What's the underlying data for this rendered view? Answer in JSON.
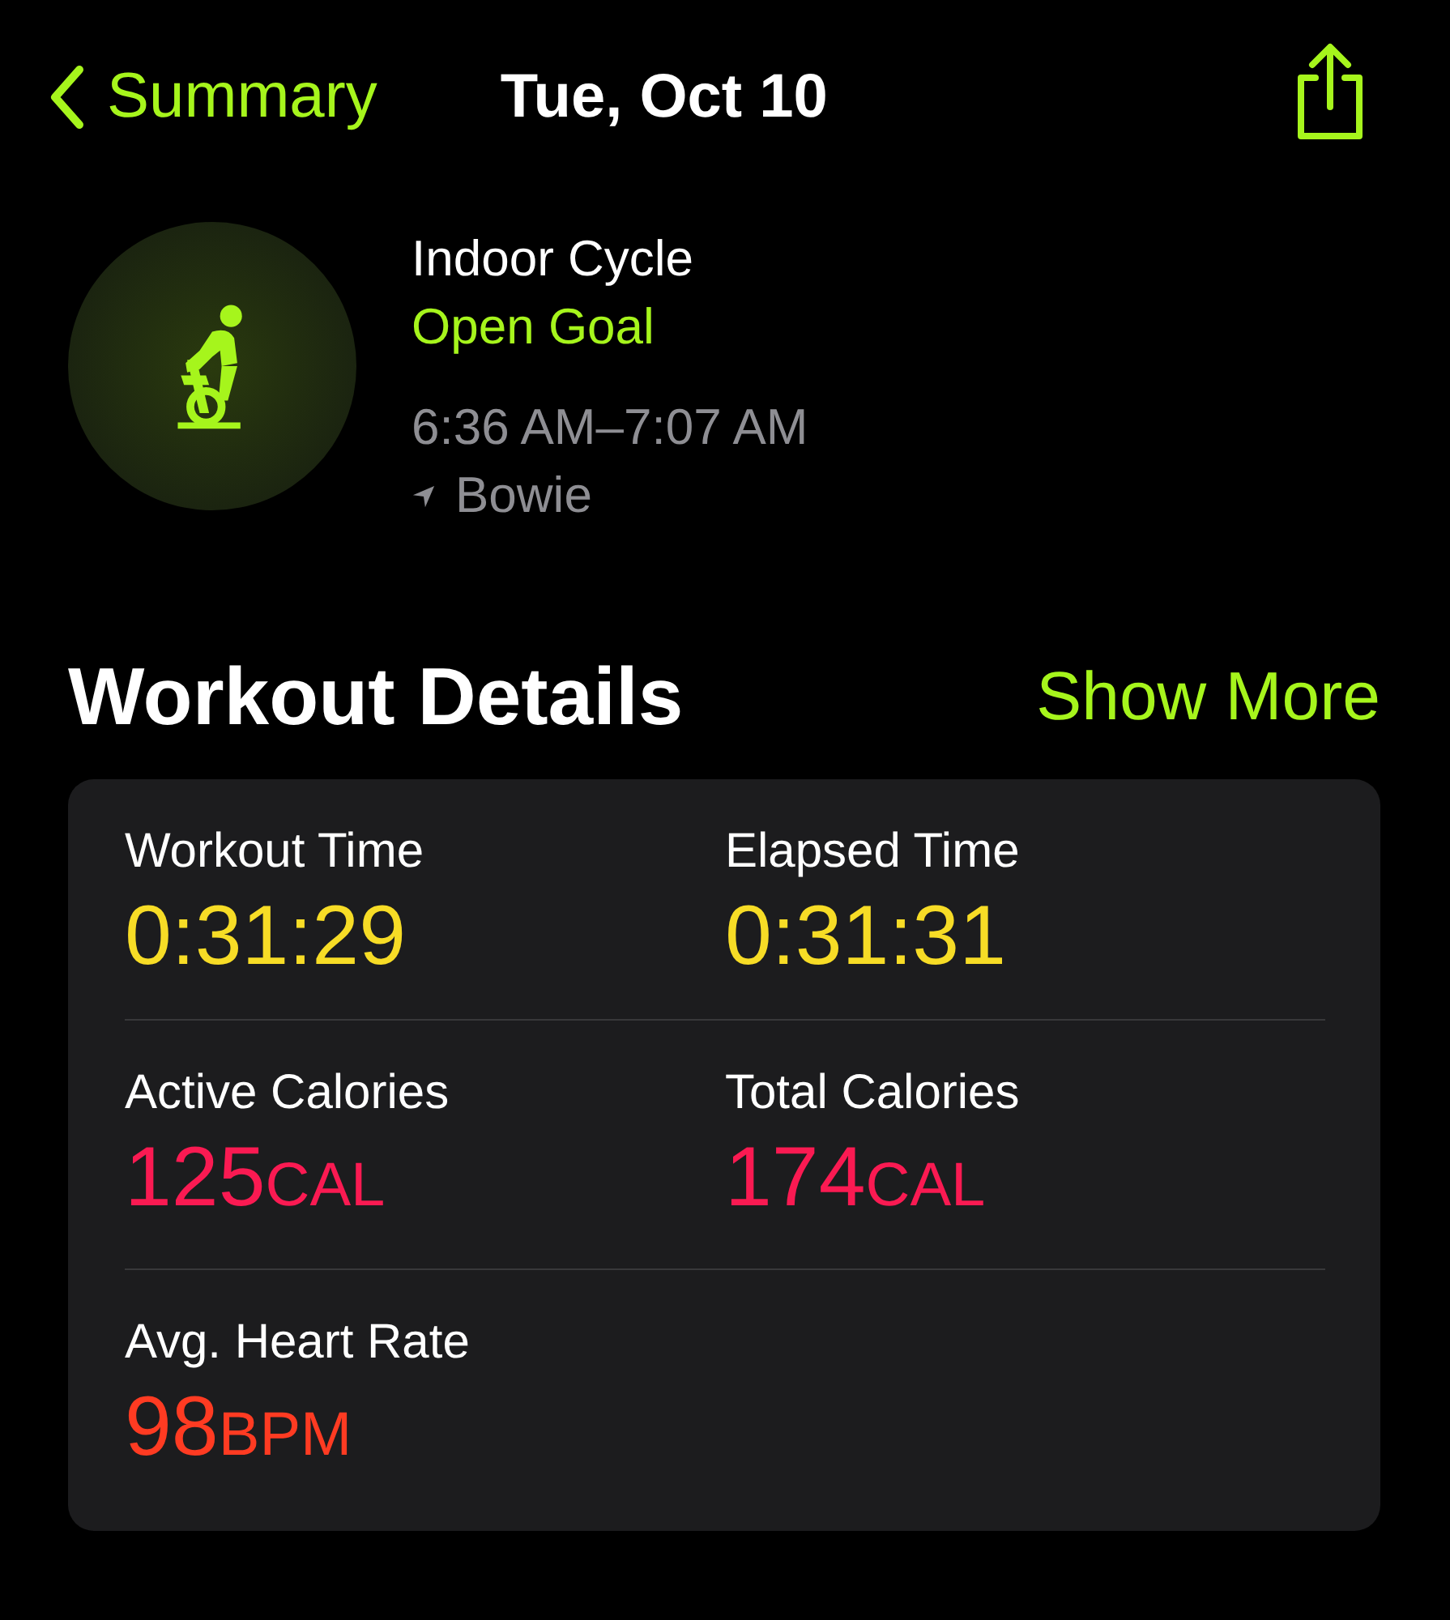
{
  "nav": {
    "back_label": "Summary",
    "title": "Tue, Oct 10"
  },
  "workout": {
    "name": "Indoor Cycle",
    "goal": "Open Goal",
    "time_range": "6:36 AM–7:07 AM",
    "location": "Bowie"
  },
  "section": {
    "title": "Workout Details",
    "action": "Show More"
  },
  "rows": [
    {
      "metrics": [
        {
          "label": "Workout Time",
          "value": "0:31:29",
          "color": "#f7dc26"
        },
        {
          "label": "Elapsed Time",
          "value": "0:31:31",
          "color": "#f7dc26"
        }
      ]
    },
    {
      "metrics": [
        {
          "label": "Active Calories",
          "value": "125",
          "unit": "CAL",
          "color": "#fa1a52"
        },
        {
          "label": "Total Calories",
          "value": "174",
          "unit": "CAL",
          "color": "#fa1a52"
        }
      ]
    },
    {
      "metrics": [
        {
          "label": "Avg. Heart Rate",
          "value": "98",
          "unit": "BPM",
          "color": "#ff3b22"
        }
      ]
    }
  ]
}
